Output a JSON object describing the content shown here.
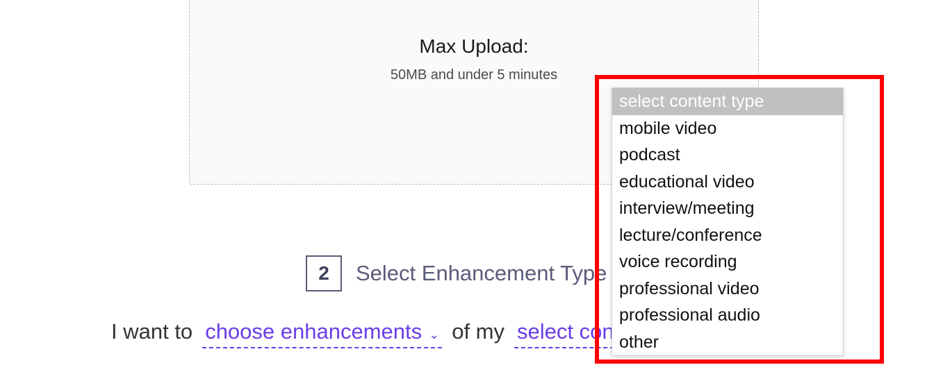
{
  "upload": {
    "title": "Max Upload:",
    "subtitle": "50MB and under 5 minutes"
  },
  "step": {
    "number": "2",
    "label": "Select Enhancement Type"
  },
  "sentence": {
    "lead": "I want to",
    "enhancements_label": "choose enhancements",
    "mid": "of my",
    "content_type_label": "select content type"
  },
  "content_type_options": [
    "select content type",
    "mobile video",
    "podcast",
    "educational video",
    "interview/meeting",
    "lecture/conference",
    "voice recording",
    "professional video",
    "professional audio",
    "other"
  ],
  "content_type_selected_index": 0
}
